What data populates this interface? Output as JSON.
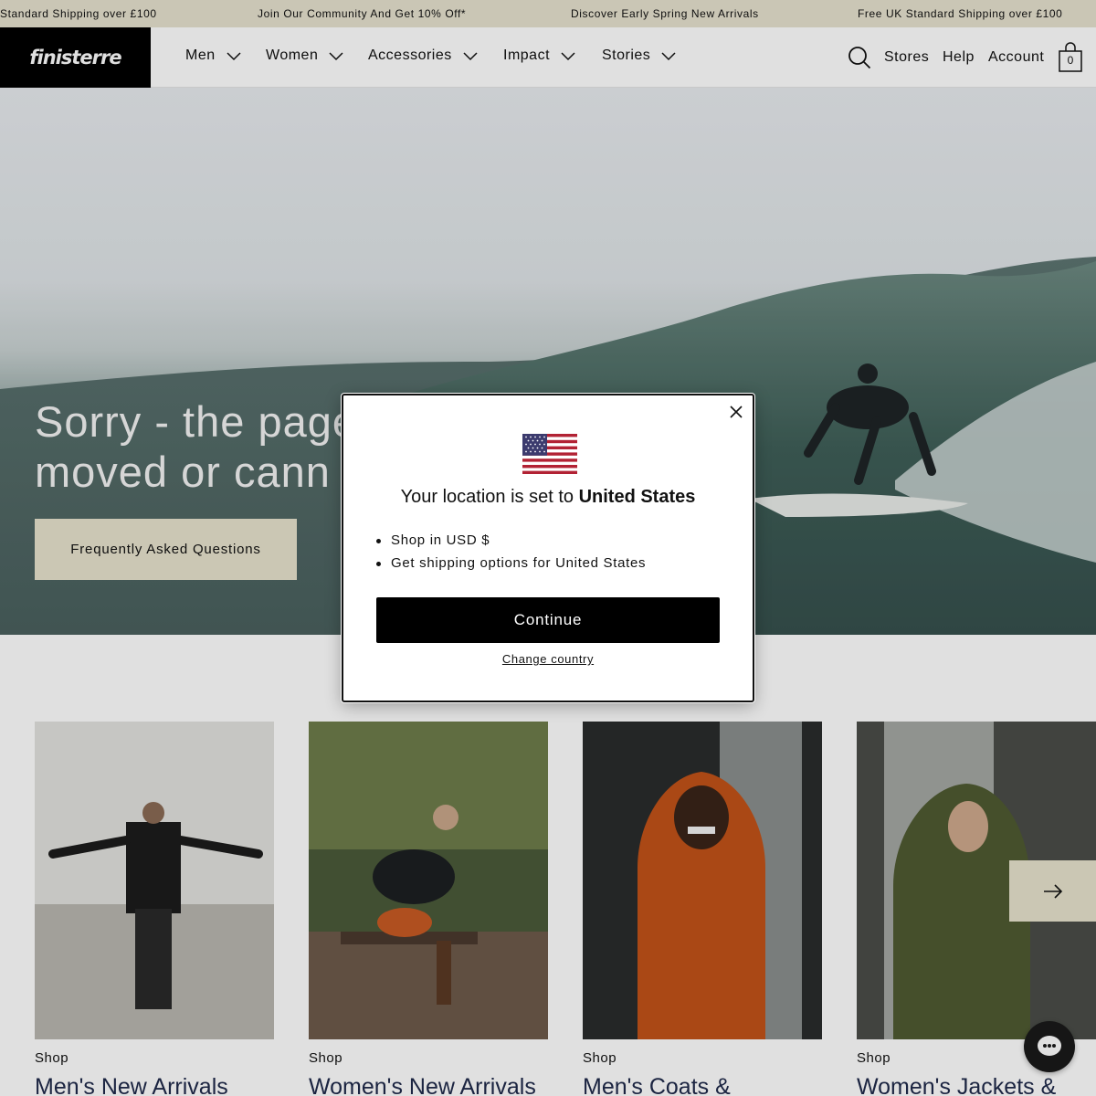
{
  "announcement": {
    "items": [
      "Standard Shipping over £100",
      "Join Our Community And Get 10% Off*",
      "Discover Early Spring New Arrivals",
      "Free UK Standard Shipping over £100"
    ]
  },
  "header": {
    "logo": "finisterre",
    "nav": [
      "Men",
      "Women",
      "Accessories",
      "Impact",
      "Stories"
    ],
    "util": {
      "stores": "Stores",
      "help": "Help",
      "account": "Account"
    },
    "cart_count": "0",
    "icons": {
      "search": "search-icon",
      "cart": "bag-icon",
      "chevron": "chevron-down-icon"
    }
  },
  "hero": {
    "title_line1": "Sorry - the page",
    "title_line2": "moved or cann",
    "button": "Frequently Asked Questions"
  },
  "cards": [
    {
      "label": "Shop",
      "title": "Men's New Arrivals"
    },
    {
      "label": "Shop",
      "title": "Women's New Arrivals"
    },
    {
      "label": "Shop",
      "title": "Men's Coats &"
    },
    {
      "label": "Shop",
      "title": "Women's Jackets &"
    }
  ],
  "modal": {
    "heading_prefix": "Your location is set to",
    "country": "United States",
    "bullets": [
      "Shop in USD $",
      "Get shipping options for United States"
    ],
    "continue": "Continue",
    "change": "Change country",
    "flag_icon": "us-flag-icon"
  },
  "colors": {
    "announcement_bg": "#e6e2cf",
    "accent_button": "#e7e3cd",
    "primary": "#000000",
    "title_link": "#1f2a4a"
  }
}
